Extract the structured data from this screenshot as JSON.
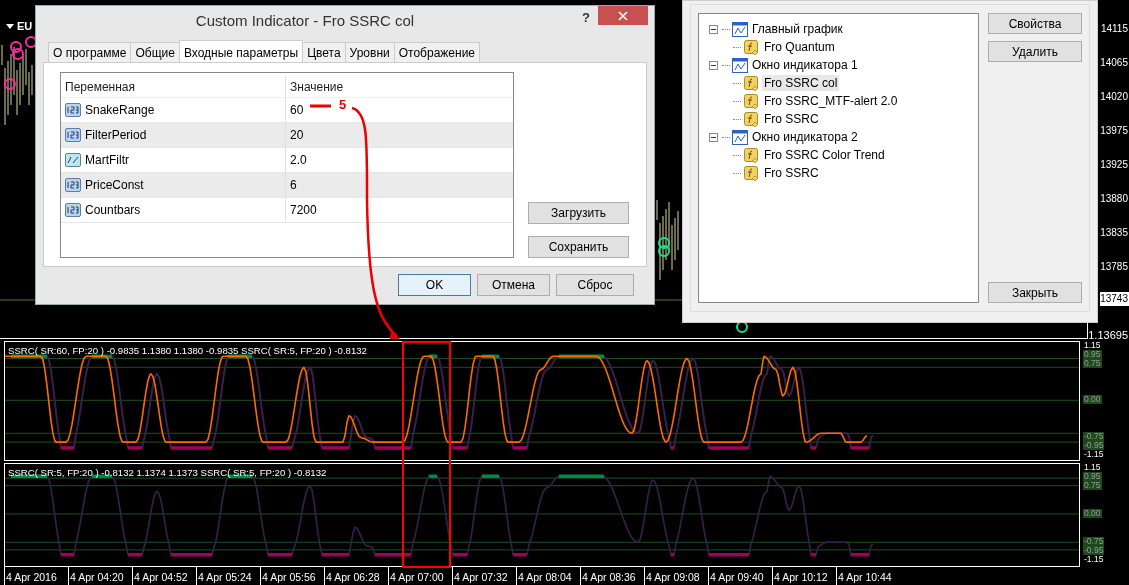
{
  "chart": {
    "symbol": "EU",
    "price_axis": [
      {
        "label": "14115",
        "current": false
      },
      {
        "label": "14065",
        "current": false
      },
      {
        "label": "14020",
        "current": false
      },
      {
        "label": "13975",
        "current": false
      },
      {
        "label": "13925",
        "current": false
      },
      {
        "label": "13880",
        "current": false
      },
      {
        "label": "13835",
        "current": false
      },
      {
        "label": "13785",
        "current": false
      },
      {
        "label": "13743",
        "current": true
      }
    ],
    "bottom_price": "1.13695"
  },
  "indicator_panes": [
    {
      "legend": "SSRC( SR:60, FP:20 ) -0.9835 1.1380 1.1380 -0.9835  SSRC( SR:5, FP:20 ) -0.8132",
      "kind": "dual",
      "levels": [
        {
          "label": "1.15",
          "highlighted": false
        },
        {
          "label": "0.95",
          "highlighted": true
        },
        {
          "label": "0.75",
          "highlighted": true
        },
        {
          "label": "0.00",
          "highlighted": true
        },
        {
          "label": "-0.75",
          "highlighted": true
        },
        {
          "label": "-0.95",
          "highlighted": true
        },
        {
          "label": "-1.15",
          "highlighted": false
        }
      ]
    },
    {
      "legend": "SSRC( SR:5, FP:20 ) -0.8132 1.1374 1.1373  SSRC( SR:5, FP:20 ) -0.8132",
      "kind": "single",
      "levels": [
        {
          "label": "1.15",
          "highlighted": false
        },
        {
          "label": "0.95",
          "highlighted": true
        },
        {
          "label": "0.75",
          "highlighted": true
        },
        {
          "label": "0.00",
          "highlighted": true
        },
        {
          "label": "-0.75",
          "highlighted": true
        },
        {
          "label": "-0.95",
          "highlighted": true
        },
        {
          "label": "-1.15",
          "highlighted": false
        }
      ]
    }
  ],
  "time_axis": [
    "4 Apr 2016",
    "4 Apr 04:20",
    "4 Apr 04:52",
    "4 Apr 05:24",
    "4 Apr 05:56",
    "4 Apr 06:28",
    "4 Apr 07:00",
    "4 Apr 07:32",
    "4 Apr 08:04",
    "4 Apr 08:36",
    "4 Apr 09:08",
    "4 Apr 09:40",
    "4 Apr 10:12",
    "4 Apr 10:44"
  ],
  "dialog": {
    "title": "Custom Indicator - Fro SSRC col",
    "help": "?",
    "tabs": [
      {
        "label": "О программе",
        "selected": false
      },
      {
        "label": "Общие",
        "selected": false
      },
      {
        "label": "Входные параметры",
        "selected": true
      },
      {
        "label": "Цвета",
        "selected": false
      },
      {
        "label": "Уровни",
        "selected": false
      },
      {
        "label": "Отображение",
        "selected": false
      }
    ],
    "table": {
      "columns": [
        "Переменная",
        "Значение"
      ],
      "rows": [
        {
          "name": "SnakeRange",
          "value": "60",
          "kind": "integer"
        },
        {
          "name": "FilterPeriod",
          "value": "20",
          "kind": "integer"
        },
        {
          "name": "MartFiltr",
          "value": "2.0",
          "kind": "double"
        },
        {
          "name": "PriceConst",
          "value": "6",
          "kind": "integer"
        },
        {
          "name": "Countbars",
          "value": "7200",
          "kind": "integer"
        }
      ]
    },
    "side_buttons": [
      "Загрузить",
      "Сохранить"
    ],
    "buttons": [
      {
        "label": "OK",
        "default": true
      },
      {
        "label": "Отмена",
        "default": false
      },
      {
        "label": "Сброс",
        "default": false
      }
    ]
  },
  "annotation": {
    "label": "5"
  },
  "indicator_list": {
    "tree": [
      {
        "label": "Главный график",
        "expanded": true,
        "children": [
          {
            "label": "Fro Quantum",
            "selected": false
          }
        ]
      },
      {
        "label": "Окно индикатора 1",
        "expanded": true,
        "children": [
          {
            "label": "Fro SSRC col",
            "selected": true
          },
          {
            "label": "Fro SSRC_MTF-alert 2.0",
            "selected": false
          },
          {
            "label": "Fro SSRC",
            "selected": false
          }
        ]
      },
      {
        "label": "Окно индикатора 2",
        "expanded": true,
        "children": [
          {
            "label": "Fro SSRC Color Trend",
            "selected": false
          },
          {
            "label": "Fro SSRC",
            "selected": false
          }
        ]
      }
    ],
    "buttons": [
      "Свойства",
      "Удалить"
    ],
    "close_button": "Закрыть"
  }
}
